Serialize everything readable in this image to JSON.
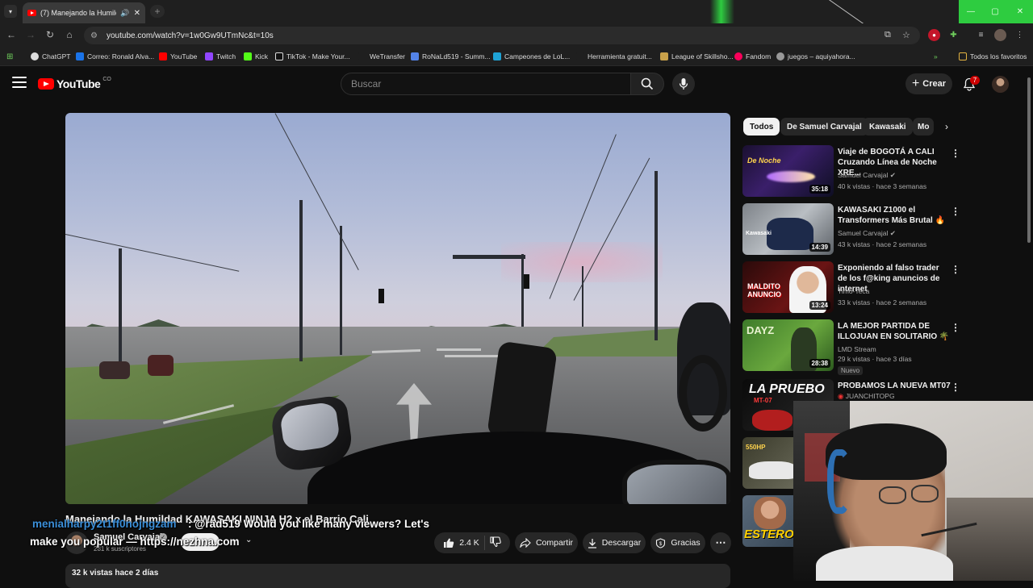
{
  "browser": {
    "tab_title": "(7) Manejando la Humildad KAWASAKI NINJA H2 x el Barrio Cali",
    "url": "youtube.com/watch?v=1w0Gw9UTmNc&t=10s",
    "bookmarks": [
      {
        "label": "ChatGPT",
        "icon": "chatgpt-icon",
        "color": "#ffffff"
      },
      {
        "label": "Correo: Ronald Alva...",
        "icon": "outlook-icon",
        "color": "#1a73e8"
      },
      {
        "label": "YouTube",
        "icon": "youtube-icon",
        "color": "#ff0000"
      },
      {
        "label": "Twitch",
        "icon": "twitch-icon",
        "color": "#9146ff"
      },
      {
        "label": "Kick",
        "icon": "kick-icon",
        "color": "#53fc18"
      },
      {
        "label": "TikTok - Make Your...",
        "icon": "tiktok-icon",
        "color": "#ffffff"
      },
      {
        "label": "WeTransfer",
        "icon": "wetransfer-icon",
        "color": "#409fff"
      },
      {
        "label": "RoNaLd519 - Summ...",
        "icon": "opgg-icon",
        "color": "#5383e8"
      },
      {
        "label": "Campeones de LoL...",
        "icon": "lol-icon",
        "color": "#1fa3d6"
      },
      {
        "label": "Herramienta gratuit...",
        "icon": "tool-icon",
        "color": "#f2c744"
      },
      {
        "label": "League of Skillsho...",
        "icon": "skillshot-icon",
        "color": "#c9a14a"
      },
      {
        "label": "Fandom",
        "icon": "fandom-icon",
        "color": "#fa005a"
      },
      {
        "label": "juegos – aquiyahora...",
        "icon": "globe-icon",
        "color": "#999999"
      }
    ],
    "all_bookmarks_label": "Todos los favoritos"
  },
  "masthead": {
    "logo_text": "YouTube",
    "logo_region": "CO",
    "search_placeholder": "Buscar",
    "create_label": "Crear",
    "notification_count": "7"
  },
  "video": {
    "title": "Manejando la Humildad KAWASAKI NINJA H2 x el Barrio Cali",
    "channel": "Samuel Carvajal",
    "subscribers": "281 k suscriptores",
    "likes": "2.4 K",
    "share_label": "Compartir",
    "download_label": "Descargar",
    "thanks_label": "Gracias",
    "stats": "32 k vistas  hace 2 días"
  },
  "chat_overlay": {
    "username": "menialharpy2t1ff0nojngzam",
    "message_line1": ": @rad519 Would you like many viewers? Let's",
    "message_line2": "make you popular — https://nezhna.com"
  },
  "chips": [
    {
      "label": "Todos",
      "active": true
    },
    {
      "label": "De Samuel Carvajal",
      "active": false
    },
    {
      "label": "Kawasaki",
      "active": false
    },
    {
      "label": "Mo",
      "active": false
    }
  ],
  "recommendations": [
    {
      "title": "Viaje de BOGOTÁ A CALI Cruzando Línea de Noche XRE...",
      "channel": "Samuel Carvajal",
      "verified": true,
      "meta": "40 k vistas · hace 3 semanas",
      "duration": "35:18",
      "thumb_text": "De Noche"
    },
    {
      "title": "KAWASAKI Z1000  el Transformers Más Brutal 🔥",
      "channel": "Samuel Carvajal",
      "verified": true,
      "meta": "43 k vistas · hace 2 semanas",
      "duration": "14:39",
      "thumb_text": "Kawasaki"
    },
    {
      "title": "Exponiendo al falso trader de los f@king anuncios de internet",
      "channel": "Timo-Teca",
      "verified": false,
      "meta": "33 k vistas · hace 2 semanas",
      "duration": "13:24",
      "thumb_text": "MALDITO ANUNCIO"
    },
    {
      "title": "LA MEJOR PARTIDA DE ILLOJUAN EN SOLITARIO 🌴",
      "channel": "LMD Stream",
      "verified": false,
      "meta": "29 k vistas · hace 3 días",
      "duration": "28:38",
      "thumb_text": "DAYZ",
      "badge": "Nuevo"
    },
    {
      "title": "PROBAMOS LA NUEVA MT07",
      "channel": "JUANCHITOPG",
      "verified": false,
      "meta": "",
      "duration": "",
      "thumb_text": "LA PRUEBO"
    },
    {
      "title": "",
      "channel": "",
      "verified": false,
      "meta": "",
      "duration": "",
      "thumb_text": "ESTERO"
    }
  ],
  "thumb_labels": {
    "rec5_sub": "MT-07",
    "rec6_text": "550HP"
  }
}
